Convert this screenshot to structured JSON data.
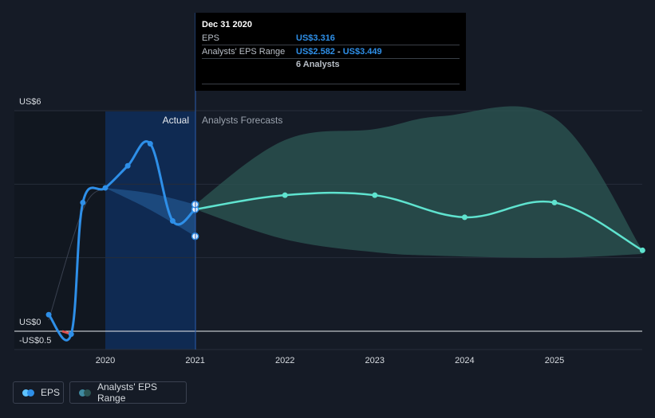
{
  "tooltip": {
    "date": "Dec 31 2020",
    "eps_label": "EPS",
    "eps_value": "US$3.316",
    "range_label": "Analysts' EPS Range",
    "range_low": "US$2.582",
    "range_sep": " - ",
    "range_high": "US$3.449",
    "analysts": "6 Analysts"
  },
  "labels": {
    "actual": "Actual",
    "forecasts": "Analysts Forecasts"
  },
  "legend": {
    "eps": "EPS",
    "range": "Analysts' EPS Range"
  },
  "colors": {
    "background": "#151b26",
    "eps_line": "#2e8fe8",
    "forecast_line": "#5fe3cf",
    "forecast_band": "#2c5452",
    "actual_band": "#1f4f85",
    "highlight": "#0f2a52",
    "negative_segment": "#e05252"
  },
  "chart_data": {
    "type": "line",
    "ylim": [
      -0.5,
      6
    ],
    "y_ticks": [
      {
        "value": 6,
        "label": "US$6"
      },
      {
        "value": 0,
        "label": "US$0"
      },
      {
        "value": -0.5,
        "label": "-US$0.5"
      }
    ],
    "x_ticks": [
      "2020",
      "2021",
      "2022",
      "2023",
      "2024",
      "2025"
    ],
    "xlim": [
      2019.25,
      2025.98
    ],
    "series": [
      {
        "name": "EPS",
        "points": [
          {
            "x": 2019.37,
            "y": 0.45
          },
          {
            "x": 2019.62,
            "y": -0.08
          },
          {
            "x": 2019.75,
            "y": 3.5
          },
          {
            "x": 2020.0,
            "y": 3.9
          },
          {
            "x": 2020.25,
            "y": 4.5
          },
          {
            "x": 2020.5,
            "y": 5.1
          },
          {
            "x": 2020.75,
            "y": 3.0
          },
          {
            "x": 2021.0,
            "y": 3.316
          }
        ]
      },
      {
        "name": "EPS forecast",
        "points": [
          {
            "x": 2021.0,
            "y": 3.316
          },
          {
            "x": 2022.0,
            "y": 3.7
          },
          {
            "x": 2023.0,
            "y": 3.7
          },
          {
            "x": 2024.0,
            "y": 3.1
          },
          {
            "x": 2025.0,
            "y": 3.5
          },
          {
            "x": 2025.98,
            "y": 2.2
          }
        ]
      }
    ],
    "actual_range": [
      {
        "x": 2020.0,
        "high": 3.9,
        "low": 3.9
      },
      {
        "x": 2020.5,
        "high": 3.75,
        "low": 3.3
      },
      {
        "x": 2021.0,
        "high": 3.449,
        "low": 2.582
      }
    ],
    "forecast_range": [
      {
        "x": 2021.0,
        "high": 3.449,
        "low": 3.316
      },
      {
        "x": 2022.0,
        "high": 5.2,
        "low": 2.5
      },
      {
        "x": 2023.0,
        "high": 5.5,
        "low": 2.15
      },
      {
        "x": 2023.75,
        "high": 5.85,
        "low": 2.05
      },
      {
        "x": 2025.0,
        "high": 5.8,
        "low": 2.0
      },
      {
        "x": 2025.98,
        "high": 2.2,
        "low": 2.1
      }
    ]
  }
}
